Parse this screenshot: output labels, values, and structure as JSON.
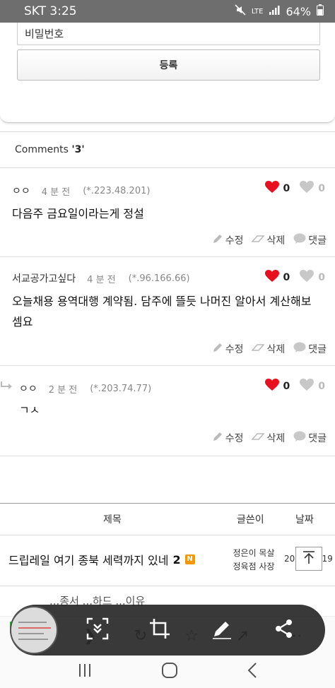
{
  "status_bar": {
    "carrier": "SKT",
    "time": "3:25",
    "network": "LTE",
    "battery": "64%"
  },
  "form": {
    "password_placeholder": "비밀번호",
    "register_label": "등록"
  },
  "comments": {
    "heading": "Comments",
    "count": "'3'",
    "items": [
      {
        "author": "ㅇㅇ",
        "time": "4 분 전",
        "ip": "(*.223.48.201)",
        "likes": "0",
        "dislikes": "0",
        "text": "다음주 금요일이라는게 정설",
        "edit": "수정",
        "delete": "삭제",
        "reply": "댓글"
      },
      {
        "author": "서교공가고싶다",
        "time": "4 분 전",
        "ip": "(*.96.166.66)",
        "likes": "0",
        "dislikes": "0",
        "text": "오늘채용 용역대행 계약됨. 담주에 뜰듯 나머진 알아서 계산해보셈요",
        "edit": "수정",
        "delete": "삭제",
        "reply": "댓글"
      },
      {
        "author": "ㅇㅇ",
        "time": "2 분 전",
        "ip": "(*.203.74.77)",
        "likes": "0",
        "dislikes": "0",
        "text": "ㄱㅅ",
        "edit": "수정",
        "delete": "삭제",
        "reply": "댓글"
      }
    ]
  },
  "board_list": {
    "headers": {
      "title": "제목",
      "author": "글쓴이",
      "date": "날짜"
    },
    "rows": [
      {
        "title": "드립레일 여기 종북 세력까지 있네",
        "comment_count": "2",
        "badge": "N",
        "author": "정은이 목살 정육점 사장",
        "date": "2019.04.19"
      }
    ],
    "partial_row": "...종서 ...하드 ...이유"
  },
  "colors": {
    "heart": "#e8101f",
    "heart_inactive": "#c8c8c8",
    "badge": "#f39800",
    "capture_bar": "#1e1e1e"
  },
  "icons": [
    "mute-icon",
    "signal-icon",
    "heart-icon",
    "pencil-icon",
    "eraser-icon",
    "speech-bubble-icon",
    "reply-arrow-icon",
    "back-to-top-icon",
    "scroll-capture-icon",
    "crop-icon",
    "draw-icon",
    "share-icon",
    "recent-apps-icon",
    "home-icon",
    "back-icon"
  ]
}
